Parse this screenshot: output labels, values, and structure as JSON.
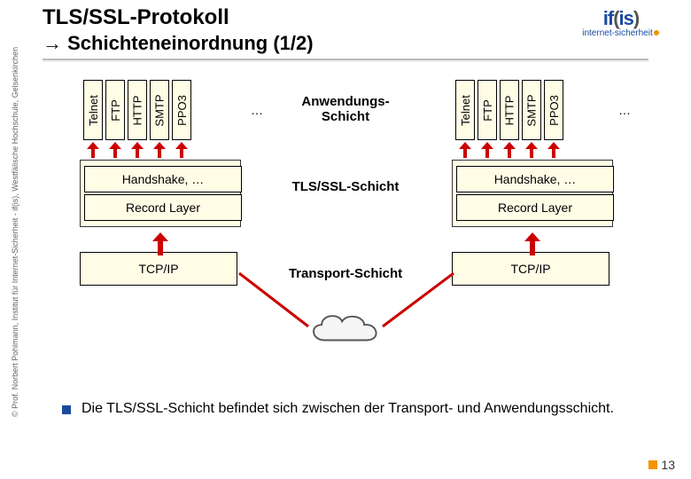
{
  "header": {
    "title": "TLS/SSL-Protokoll",
    "subtitle_arrow": "→",
    "subtitle": "Schichteneinordnung (1/2)"
  },
  "logo": {
    "main": "if(is)",
    "sub": "internet-sicherheit"
  },
  "sidebar_credit": "© Prof. Norbert Pohlmann, Institut für Internet-Sicherheit - if(is), Westfälische Hochschule, Gelsenkirchen",
  "protocols": [
    "Telnet",
    "FTP",
    "HTTP",
    "SMTP",
    "PPO3"
  ],
  "dots": "…",
  "layer_labels": {
    "app": "Anwendungs-Schicht",
    "tls": "TLS/SSL-Schicht",
    "trans": "Transport-Schicht"
  },
  "boxes": {
    "handshake": "Handshake, …",
    "record": "Record Layer",
    "tcpip": "TCP/IP"
  },
  "bullet": "Die TLS/SSL-Schicht befindet sich zwischen der Transport- und Anwendungsschicht.",
  "page_number": "13"
}
